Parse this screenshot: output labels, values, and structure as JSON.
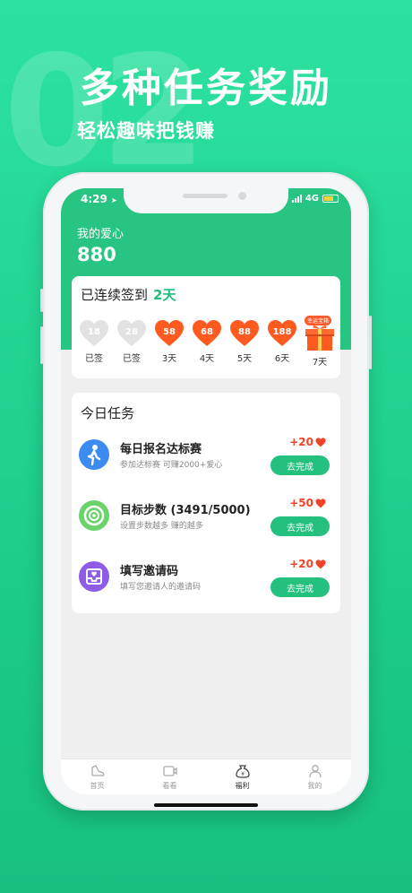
{
  "promo": {
    "bg_number": "02",
    "title": "多种任务奖励",
    "subtitle": "轻松趣味把钱赚"
  },
  "status_bar": {
    "time": "4:29",
    "network": "4G"
  },
  "header": {
    "love_label": "我的爱心",
    "love_value": "880"
  },
  "signin": {
    "title": "已连续签到",
    "days": "2天",
    "items": [
      {
        "value": "18",
        "label": "已签",
        "state": "done"
      },
      {
        "value": "28",
        "label": "已签",
        "state": "done"
      },
      {
        "value": "58",
        "label": "3天",
        "state": "pending"
      },
      {
        "value": "68",
        "label": "4天",
        "state": "pending"
      },
      {
        "value": "88",
        "label": "5天",
        "state": "pending"
      },
      {
        "value": "188",
        "label": "6天",
        "state": "pending"
      }
    ],
    "gift": {
      "tag": "幸运宝箱",
      "label": "7天"
    }
  },
  "tasks": {
    "title": "今日任务",
    "items": [
      {
        "name": "每日报名达标赛",
        "desc": "参加达标赛 可赚2000+爱心",
        "reward": "+20",
        "button": "去完成",
        "icon": "walking-person-icon"
      },
      {
        "name": "目标步数 (3491/5000)",
        "desc": "设置步数越多 赚的越多",
        "reward": "+50",
        "button": "去完成",
        "icon": "target-steps-icon"
      },
      {
        "name": "填写邀请码",
        "desc": "填写您邀请人的邀请码",
        "reward": "+20",
        "button": "去完成",
        "icon": "invite-inbox-icon"
      }
    ]
  },
  "tabbar": {
    "items": [
      {
        "label": "首页",
        "icon": "shoe-icon"
      },
      {
        "label": "看看",
        "icon": "video-icon"
      },
      {
        "label": "福利",
        "icon": "money-bag-icon"
      },
      {
        "label": "我的",
        "icon": "person-icon"
      }
    ]
  },
  "colors": {
    "brand_green": "#27c482",
    "heart_orange": "#ff5a1f",
    "reward_red": "#f0442a"
  }
}
